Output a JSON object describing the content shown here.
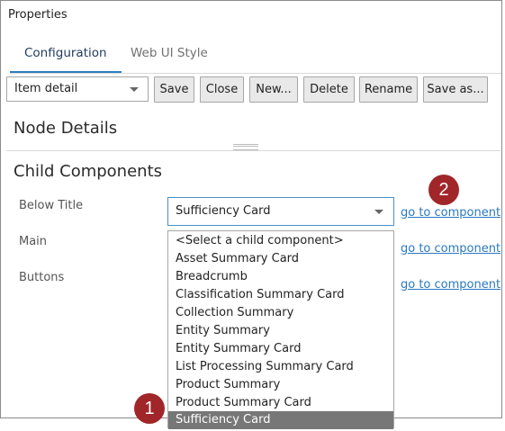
{
  "window": {
    "title": "Properties"
  },
  "tabs": [
    {
      "label": "Configuration",
      "active": true
    },
    {
      "label": "Web UI Style",
      "active": false
    }
  ],
  "toolbar": {
    "item_select": "Item detail",
    "buttons": [
      "Save",
      "Close",
      "New...",
      "Delete",
      "Rename",
      "Save as..."
    ]
  },
  "sections": {
    "node_details": "Node Details",
    "child_components": "Child Components"
  },
  "rows": [
    {
      "label": "Below Title",
      "link": "go to component"
    },
    {
      "label": "Main",
      "link": "go to component"
    },
    {
      "label": "Buttons",
      "link": "go to component"
    }
  ],
  "child_select": {
    "value": "Sufficiency Card"
  },
  "dropdown_options": [
    "<Select a child component>",
    "Asset Summary Card",
    "Breadcrumb",
    "Classification Summary Card",
    "Collection Summary",
    "Entity Summary",
    "Entity Summary Card",
    "List Processing Summary Card",
    "Product Summary",
    "Product Summary Card",
    "Sufficiency Card"
  ],
  "selected_option_index": 10,
  "callouts": [
    "1",
    "2"
  ],
  "colors": {
    "callout": "#a0262a",
    "link": "#2a78c0",
    "tab_accent": "#2e7fc1",
    "selected": "#777777"
  }
}
